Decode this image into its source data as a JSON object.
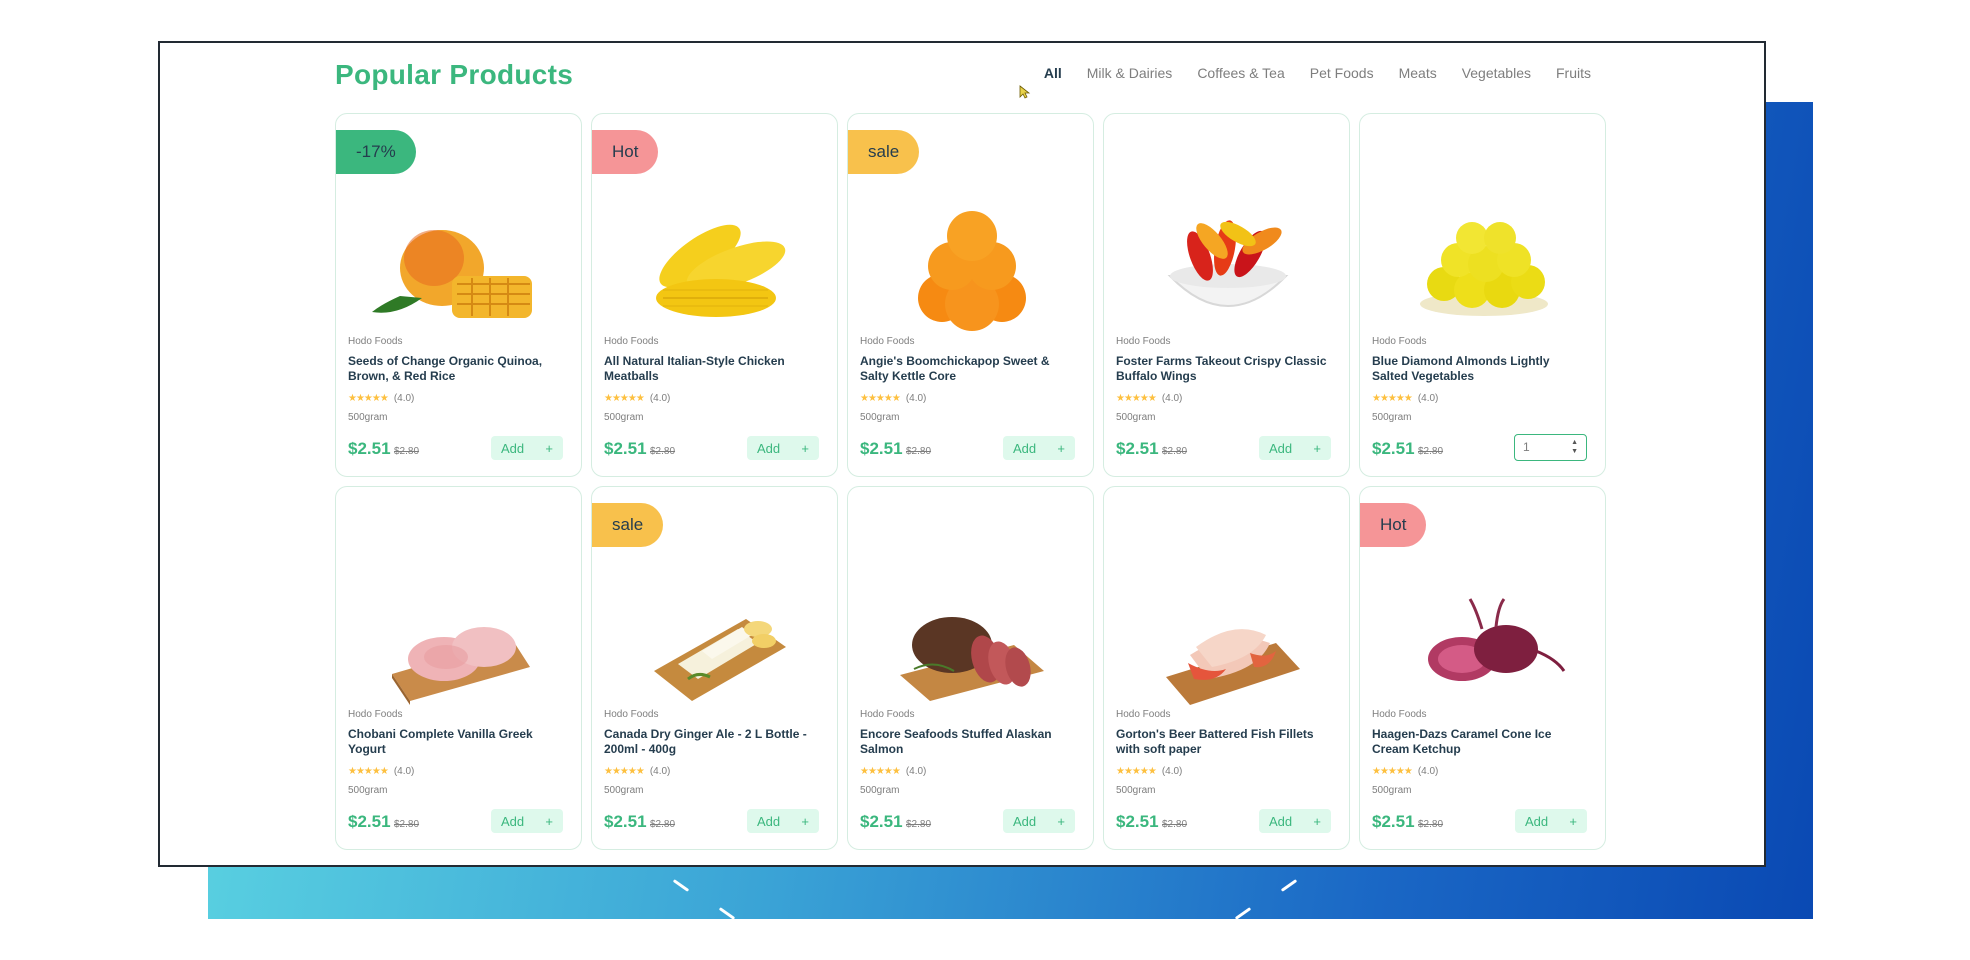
{
  "header": {
    "title": "Popular Products",
    "tabs": [
      "All",
      "Milk & Dairies",
      "Coffees & Tea",
      "Pet Foods",
      "Meats",
      "Vegetables",
      "Fruits"
    ],
    "active_tab": "All"
  },
  "colors": {
    "brand": "#3bb77e",
    "badge_discount": "#3bb77e",
    "badge_hot": "#f59597",
    "badge_sale": "#f8c14c",
    "add_button_bg": "#def9ec",
    "star": "#fdc040",
    "backdrop_gradient_start": "#5fd9e3",
    "backdrop_gradient_end": "#0a49b3"
  },
  "products": [
    {
      "badge": "-17%",
      "badge_type": "green",
      "image_icon": "mango-icon",
      "vendor": "Hodo Foods",
      "name": "Seeds of Change Organic Quinoa, Brown, & Red Rice",
      "stars": "★★★★★",
      "rating_value": 4.0,
      "rating": "(4.0)",
      "weight": "500gram",
      "price": "$2.51",
      "old_price": "$2.80",
      "add_label": "Add",
      "add_icon": "+"
    },
    {
      "badge": "Hot",
      "badge_type": "red",
      "image_icon": "corn-icon",
      "vendor": "Hodo Foods",
      "name": "All Natural Italian-Style Chicken Meatballs",
      "stars": "★★★★★",
      "rating_value": 4.0,
      "rating": "(4.0)",
      "weight": "500gram",
      "price": "$2.51",
      "old_price": "$2.80",
      "add_label": "Add",
      "add_icon": "+"
    },
    {
      "badge": "sale",
      "badge_type": "yellow",
      "image_icon": "orange-icon",
      "vendor": "Hodo Foods",
      "name": "Angie's Boomchickapop Sweet & Salty Kettle Core",
      "stars": "★★★★★",
      "rating_value": 4.0,
      "rating": "(4.0)",
      "weight": "500gram",
      "price": "$2.51",
      "old_price": "$2.80",
      "add_label": "Add",
      "add_icon": "+"
    },
    {
      "badge": "",
      "badge_type": "",
      "image_icon": "peppers-icon",
      "vendor": "Hodo Foods",
      "name": "Foster Farms Takeout Crispy Classic Buffalo Wings",
      "stars": "★★★★★",
      "rating_value": 4.0,
      "rating": "(4.0)",
      "weight": "500gram",
      "price": "$2.51",
      "old_price": "$2.80",
      "add_label": "Add",
      "add_icon": "+"
    },
    {
      "badge": "",
      "badge_type": "",
      "image_icon": "lemons-icon",
      "vendor": "Hodo Foods",
      "name": "Blue Diamond Almonds Lightly Salted Vegetables",
      "stars": "★★★★★",
      "rating_value": 4.0,
      "rating": "(4.0)",
      "weight": "500gram",
      "price": "$2.51",
      "old_price": "$2.80",
      "quantity": "1"
    },
    {
      "badge": "",
      "badge_type": "",
      "image_icon": "meat-board-icon",
      "vendor": "Hodo Foods",
      "name": "Chobani Complete Vanilla Greek Yogurt",
      "stars": "★★★★★",
      "rating_value": 4.0,
      "rating": "(4.0)",
      "weight": "500gram",
      "price": "$2.51",
      "old_price": "$2.80",
      "add_label": "Add",
      "add_icon": "+"
    },
    {
      "badge": "sale",
      "badge_type": "yellow",
      "image_icon": "fish-board-icon",
      "vendor": "Hodo Foods",
      "name": "Canada Dry Ginger Ale - 2 L Bottle - 200ml - 400g",
      "stars": "★★★★★",
      "rating_value": 4.0,
      "rating": "(4.0)",
      "weight": "500gram",
      "price": "$2.51",
      "old_price": "$2.80",
      "add_label": "Add",
      "add_icon": "+"
    },
    {
      "badge": "",
      "badge_type": "",
      "image_icon": "roast-beef-icon",
      "vendor": "Hodo Foods",
      "name": "Encore Seafoods Stuffed Alaskan Salmon",
      "stars": "★★★★★",
      "rating_value": 4.0,
      "rating": "(4.0)",
      "weight": "500gram",
      "price": "$2.51",
      "old_price": "$2.80",
      "add_label": "Add",
      "add_icon": "+"
    },
    {
      "badge": "",
      "badge_type": "",
      "image_icon": "ham-slices-icon",
      "vendor": "Hodo Foods",
      "name": "Gorton's Beer Battered Fish Fillets with soft paper",
      "stars": "★★★★★",
      "rating_value": 4.0,
      "rating": "(4.0)",
      "weight": "500gram",
      "price": "$2.51",
      "old_price": "$2.80",
      "add_label": "Add",
      "add_icon": "+"
    },
    {
      "badge": "Hot",
      "badge_type": "red",
      "image_icon": "beets-icon",
      "vendor": "Hodo Foods",
      "name": "Haagen-Dazs Caramel Cone Ice Cream Ketchup",
      "stars": "★★★★★",
      "rating_value": 4.0,
      "rating": "(4.0)",
      "weight": "500gram",
      "price": "$2.51",
      "old_price": "$2.80",
      "add_label": "Add",
      "add_icon": "+"
    }
  ]
}
